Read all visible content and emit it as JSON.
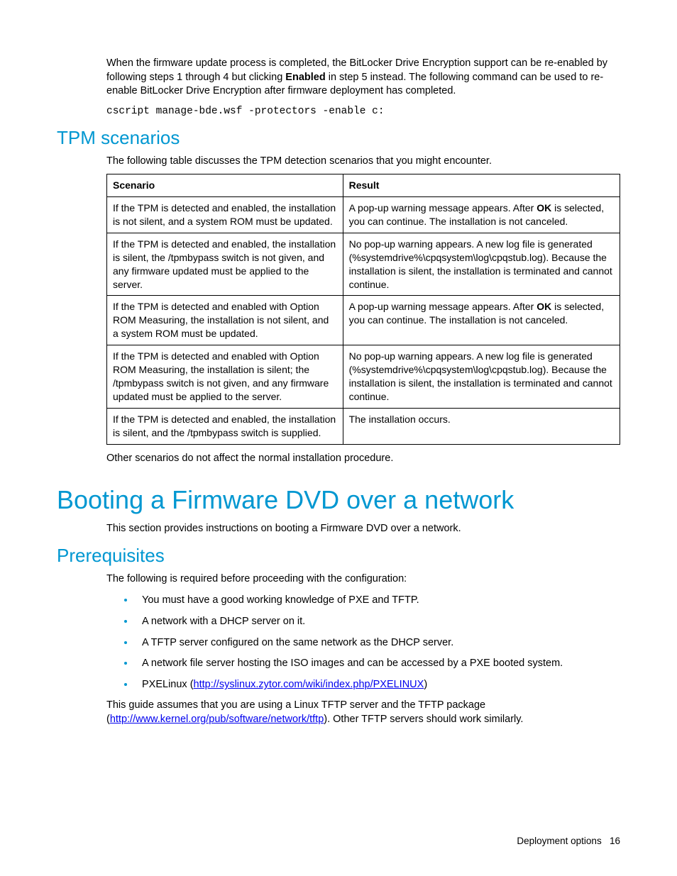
{
  "intro": {
    "para1_a": "When the firmware update process is completed, the BitLocker Drive Encryption support can be re-enabled by following steps 1 through 4 but clicking ",
    "para1_bold": "Enabled",
    "para1_b": " in step 5 instead. The following command can be used to re-enable BitLocker Drive Encryption after firmware deployment has completed.",
    "code": "cscript manage-bde.wsf -protectors -enable c:"
  },
  "tpm": {
    "heading": "TPM scenarios",
    "lead": "The following table discusses the TPM detection scenarios that you might encounter.",
    "headers": {
      "col1": "Scenario",
      "col2": "Result"
    },
    "rows": [
      {
        "scenario": "If the TPM is detected and enabled, the installation is not silent, and a system ROM must be updated.",
        "result_a": "A pop-up warning message appears. After ",
        "result_bold": "OK",
        "result_b": " is selected, you can continue. The installation is not canceled."
      },
      {
        "scenario": "If the TPM is detected and enabled, the installation is silent, the /tpmbypass switch is not given, and any firmware updated must be applied to the server.",
        "result": "No pop-up warning appears. A new log file is generated (%systemdrive%\\cpqsystem\\log\\cpqstub.log). Because the installation is silent, the installation is terminated and cannot continue."
      },
      {
        "scenario": "If the TPM is detected and enabled with Option ROM Measuring, the installation is not silent, and a system ROM must be updated.",
        "result_a": "A pop-up warning message appears. After ",
        "result_bold": "OK",
        "result_b": " is selected, you can continue. The installation is not canceled."
      },
      {
        "scenario": "If the TPM is detected and enabled with Option ROM Measuring, the installation is silent; the /tpmbypass switch is not given, and any firmware updated must be applied to the server.",
        "result": "No pop-up warning appears. A new log file is generated (%systemdrive%\\cpqsystem\\log\\cpqstub.log). Because the installation is silent, the installation is terminated and cannot continue."
      },
      {
        "scenario": "If the TPM is detected and enabled, the installation is silent, and the /tpmbypass switch is supplied.",
        "result": "The installation occurs."
      }
    ],
    "after": "Other scenarios do not affect the normal installation procedure."
  },
  "boot": {
    "heading": "Booting a Firmware DVD over a network",
    "lead": "This section provides instructions on booting a Firmware DVD over a network."
  },
  "prereq": {
    "heading": "Prerequisites",
    "lead": "The following is required before proceeding with the configuration:",
    "items": [
      "You must have a good working knowledge of PXE and TFTP.",
      "A network with a DHCP server on it.",
      "A TFTP server configured on the same network as the DHCP server.",
      "A network file server hosting the ISO images and can be accessed by a PXE booted system."
    ],
    "pxe_prefix": "PXELinux (",
    "pxe_link": "http://syslinux.zytor.com/wiki/index.php/PXELINUX",
    "pxe_suffix": ")",
    "foot_a": "This guide assumes that you are using a Linux TFTP server and the TFTP package (",
    "foot_link": "http://www.kernel.org/pub/software/network/tftp",
    "foot_b": "). Other TFTP servers should work similarly."
  },
  "footer": {
    "section": "Deployment options",
    "page": "16"
  }
}
